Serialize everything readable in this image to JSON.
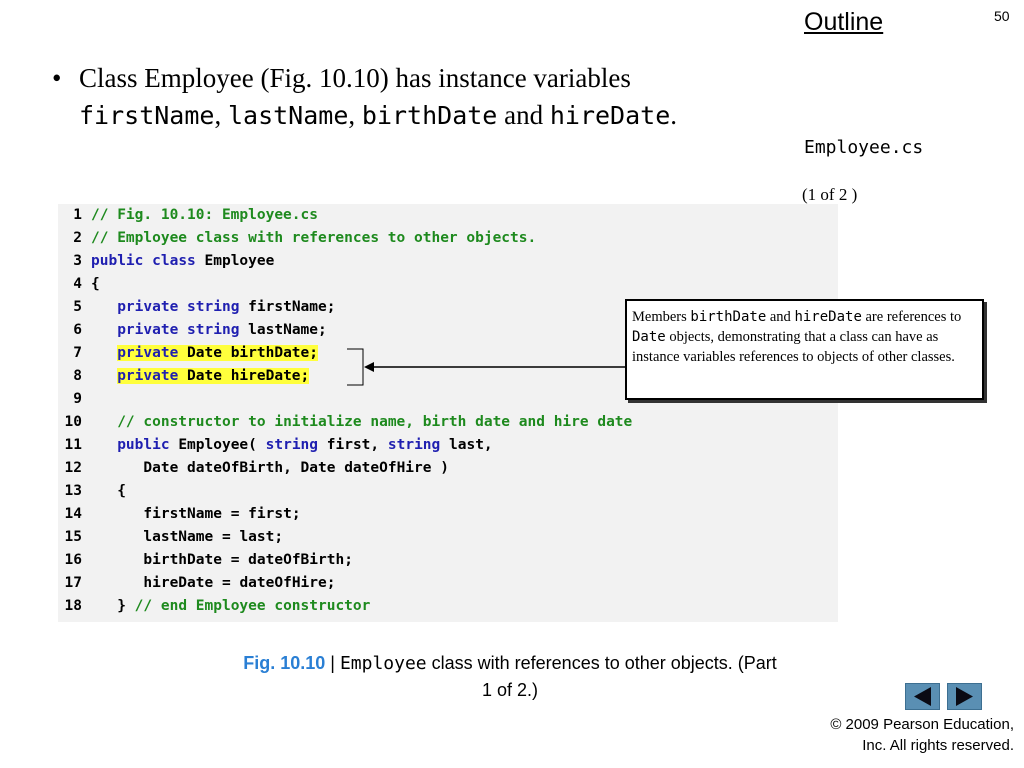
{
  "header": {
    "outline_label": "Outline",
    "page_number": "50"
  },
  "bullet": {
    "prefix": "Class Employee (Fig. 10.10) has instance variables",
    "var1": "firstName",
    "sep1": ",",
    "var2": "lastName",
    "sep2": ",",
    "var3": "birthDate",
    "and": "and",
    "var4": "hireDate",
    "end": "."
  },
  "side": {
    "file_name": "Employee.cs",
    "part_label": "(1 of 2 )"
  },
  "code": {
    "lines": [
      {
        "n": "1",
        "t": "// Fig. 10.10: Employee.cs"
      },
      {
        "n": "2",
        "t": "// Employee class with references to other objects."
      },
      {
        "n": "3",
        "t": "public class Employee"
      },
      {
        "n": "4",
        "t": "{"
      },
      {
        "n": "5",
        "t": "private string firstName;"
      },
      {
        "n": "6",
        "t": "private string lastName;"
      },
      {
        "n": "7",
        "t": "private Date birthDate;"
      },
      {
        "n": "8",
        "t": "private Date hireDate;"
      },
      {
        "n": "9",
        "t": ""
      },
      {
        "n": "10",
        "t": "// constructor to initialize name, birth date and hire date"
      },
      {
        "n": "11",
        "t": "public Employee( string first, string last,"
      },
      {
        "n": "12",
        "t": "Date dateOfBirth, Date dateOfHire )"
      },
      {
        "n": "13",
        "t": "{"
      },
      {
        "n": "14",
        "t": "firstName = first;"
      },
      {
        "n": "15",
        "t": "lastName = last;"
      },
      {
        "n": "16",
        "t": "birthDate = dateOfBirth;"
      },
      {
        "n": "17",
        "t": "hireDate = dateOfHire;"
      },
      {
        "n": "18",
        "t": "} // end Employee constructor"
      }
    ]
  },
  "callout": {
    "p1": "Members ",
    "m1": "birthDate",
    "p2": " and ",
    "m2": "hireDate",
    "p3": " are references to ",
    "m3": "Date",
    "p4": " objects, demonstrating that a class can have as instance variables references to objects of other classes."
  },
  "caption": {
    "fig": "Fig. 10.10",
    "sep": " | ",
    "class_name": "Employee",
    "rest": " class with references to other objects. (Part 1 of 2.)"
  },
  "nav": {
    "prev_icon": "left-triangle-icon",
    "next_icon": "right-triangle-icon"
  },
  "footer": {
    "copyright_line1": "© 2009 Pearson Education,",
    "copyright_line2": "Inc.  All rights reserved."
  },
  "colors": {
    "keyword": "#1f1fb0",
    "comment": "#1e8a1e",
    "highlight": "#ffff3c",
    "caption_fig": "#2a7fd4",
    "nav_button": "#5a8fb3"
  }
}
